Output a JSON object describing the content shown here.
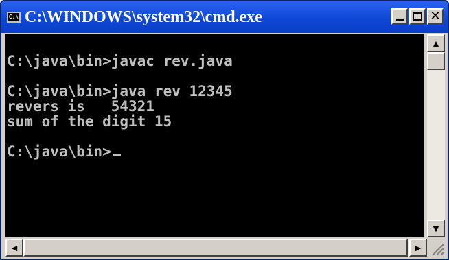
{
  "window": {
    "title": "C:\\WINDOWS\\system32\\cmd.exe",
    "icon_label": "C:\\",
    "icon": "cmd-icon"
  },
  "title_controls": {
    "minimize_icon": "minimize-icon",
    "maximize_icon": "maximize-icon",
    "close_label": "✕"
  },
  "console": {
    "lines": [
      "",
      "C:\\java\\bin>javac rev.java",
      "",
      "C:\\java\\bin>java rev 12345",
      "revers is   54321",
      "sum of the digit 15",
      "",
      "C:\\java\\bin>"
    ],
    "text_color": "#c0c0c0",
    "background": "#000000"
  },
  "scrollbars": {
    "up_arrow": "▲",
    "down_arrow": "▼",
    "left_arrow": "◀",
    "right_arrow": "▶"
  },
  "colors": {
    "titlebar": "#0f47d6",
    "frame": "#d4d0c8"
  }
}
